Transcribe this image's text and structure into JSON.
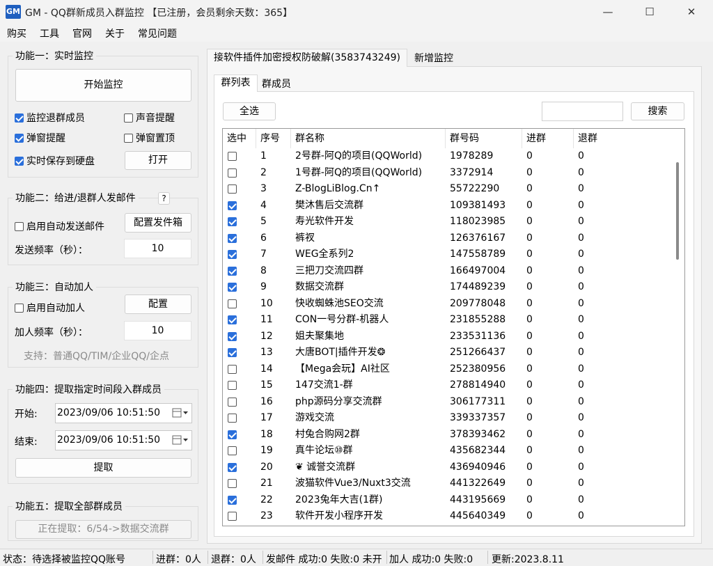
{
  "window": {
    "logo": "GM",
    "title": "GM - QQ群新成员入群监控 【已注册，会员剩余天数：365】",
    "min": "—",
    "max": "☐",
    "close": "✕"
  },
  "menu": [
    "购买",
    "工具",
    "官网",
    "关于",
    "常见问题"
  ],
  "func1": {
    "title": "功能一：实时监控",
    "start_button": "开始监控",
    "monitor_leave": "监控退群成员",
    "sound_alert": "声音提醒",
    "popup_alert": "弹窗提醒",
    "popup_top": "弹窗置顶",
    "save_disk": "实时保存到硬盘",
    "open_button": "打开"
  },
  "func2": {
    "title": "功能二：给进/退群人发邮件",
    "help": "?",
    "auto_send": "启用自动发送邮件",
    "config_button": "配置发件箱",
    "freq_label": "发送频率（秒）：",
    "freq_value": "10"
  },
  "func3": {
    "title": "功能三：自动加人",
    "auto_add": "启用自动加人",
    "config_button": "配置",
    "freq_label": "加人频率（秒）：",
    "freq_value": "10",
    "support": "支持：普通QQ/TIM/企业QQ/企点"
  },
  "func4": {
    "title": "功能四：提取指定时间段入群成员",
    "start_label": "开始:",
    "start_value": "2023/09/06 10:51:50",
    "end_label": "结束:",
    "end_value": "2023/09/06 10:51:50",
    "extract_button": "提取"
  },
  "func5": {
    "title": "功能五：提取全部群成员",
    "progress": "正在提取：6/54->数据交流群"
  },
  "tabs": {
    "main": [
      "接软件插件加密授权防破解(3583743249)",
      "新增监控"
    ],
    "sub": [
      "群列表",
      "群成员"
    ]
  },
  "toolbar": {
    "select_all": "全选",
    "search_value": "",
    "search_button": "搜索"
  },
  "table": {
    "headers": [
      "选中",
      "序号",
      "群名称",
      "群号码",
      "进群",
      "退群"
    ],
    "rows": [
      {
        "checked": false,
        "idx": "1",
        "name": "2号群-阿Q的项目(QQWorld)",
        "code": "1978289",
        "join": "0",
        "leave": "0"
      },
      {
        "checked": false,
        "idx": "2",
        "name": "1号群-阿Q的项目(QQWorld)",
        "code": "3372914",
        "join": "0",
        "leave": "0"
      },
      {
        "checked": false,
        "idx": "3",
        "name": "Z-BlogLiBlog.Cn↑",
        "code": "55722290",
        "join": "0",
        "leave": "0"
      },
      {
        "checked": true,
        "idx": "4",
        "name": "樊沐售后交流群",
        "code": "109381493",
        "join": "0",
        "leave": "0"
      },
      {
        "checked": true,
        "idx": "5",
        "name": "寿光软件开发",
        "code": "118023985",
        "join": "0",
        "leave": "0"
      },
      {
        "checked": true,
        "idx": "6",
        "name": "裤衩",
        "code": "126376167",
        "join": "0",
        "leave": "0"
      },
      {
        "checked": true,
        "idx": "7",
        "name": "WEG全系列2",
        "code": "147558789",
        "join": "0",
        "leave": "0"
      },
      {
        "checked": true,
        "idx": "8",
        "name": "三把刀交流四群",
        "code": "166497004",
        "join": "0",
        "leave": "0"
      },
      {
        "checked": true,
        "idx": "9",
        "name": "数据交流群",
        "code": "174489239",
        "join": "0",
        "leave": "0"
      },
      {
        "checked": false,
        "idx": "10",
        "name": "快收蜘蛛池SEO交流",
        "code": "209778048",
        "join": "0",
        "leave": "0"
      },
      {
        "checked": true,
        "idx": "11",
        "name": "CON一号分群-机器人",
        "code": "231855288",
        "join": "0",
        "leave": "0"
      },
      {
        "checked": true,
        "idx": "12",
        "name": "姐夫聚集地",
        "code": "233531136",
        "join": "0",
        "leave": "0"
      },
      {
        "checked": true,
        "idx": "13",
        "name": "大唐BOT|插件开发❂",
        "code": "251266437",
        "join": "0",
        "leave": "0"
      },
      {
        "checked": false,
        "idx": "14",
        "name": "【Mega会玩】AI社区",
        "code": "252380956",
        "join": "0",
        "leave": "0"
      },
      {
        "checked": false,
        "idx": "15",
        "name": "147交流1-群",
        "code": "278814940",
        "join": "0",
        "leave": "0"
      },
      {
        "checked": false,
        "idx": "16",
        "name": "php源码分享交流群",
        "code": "306177311",
        "join": "0",
        "leave": "0"
      },
      {
        "checked": false,
        "idx": "17",
        "name": "游戏交流",
        "code": "339337357",
        "join": "0",
        "leave": "0"
      },
      {
        "checked": true,
        "idx": "18",
        "name": "村兔合购网2群",
        "code": "378393462",
        "join": "0",
        "leave": "0"
      },
      {
        "checked": false,
        "idx": "19",
        "name": "真牛论坛⑩群",
        "code": "435682344",
        "join": "0",
        "leave": "0"
      },
      {
        "checked": true,
        "idx": "20",
        "name": "❦ 诚誉交流群",
        "code": "436940946",
        "join": "0",
        "leave": "0"
      },
      {
        "checked": false,
        "idx": "21",
        "name": "波猫软件Vue3/Nuxt3交流",
        "code": "441322649",
        "join": "0",
        "leave": "0"
      },
      {
        "checked": true,
        "idx": "22",
        "name": "2023兔年大吉(1群)",
        "code": "443195669",
        "join": "0",
        "leave": "0"
      },
      {
        "checked": false,
        "idx": "23",
        "name": "软件开发小程序开发",
        "code": "445640349",
        "join": "0",
        "leave": "0"
      }
    ]
  },
  "status": {
    "state": "状态：待选择被监控QQ账号",
    "join": "进群：0人",
    "leave": "退群：0人",
    "mail": "发邮件 成功:0 失败:0 未开",
    "add": "加人 成功:0 失败:0",
    "update": "更新:2023.8.11"
  },
  "colors": {
    "accent": "#2a6fdb",
    "logo_bg": "#1f5fbf"
  }
}
